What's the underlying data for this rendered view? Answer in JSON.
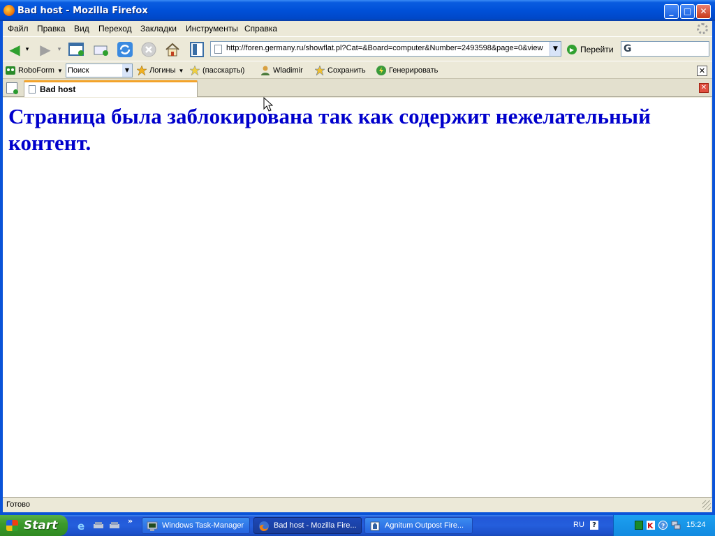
{
  "window": {
    "title": "Bad host - Mozilla Firefox",
    "controls": {
      "minimize": "_",
      "maximize": "□",
      "close": "✕"
    }
  },
  "menubar": {
    "items": [
      "Файл",
      "Правка",
      "Вид",
      "Переход",
      "Закладки",
      "Инструменты",
      "Справка"
    ]
  },
  "navbar": {
    "url": "http://foren.germany.ru/showflat.pl?Cat=&Board=computer&Number=2493598&page=0&view",
    "go_label": "Перейти",
    "search_engine_icon": "google-icon"
  },
  "robobar": {
    "roboform_label": "RoboForm",
    "search_value": "Поиск",
    "logins_label": "Логины",
    "passcards_label": "(пасскарты)",
    "user_label": "Wladimir",
    "save_label": "Сохранить",
    "generate_label": "Генерировать"
  },
  "tabs": [
    {
      "label": "Bad host",
      "active": true
    }
  ],
  "content": {
    "message": "Страница была заблокирована так как содержит нежелательный контент.",
    "message_color": "#0000cc"
  },
  "status": {
    "text": "Готово"
  },
  "taskbar": {
    "start_label": "Start",
    "quicklaunch_more": "»",
    "tasks": [
      {
        "label": "Windows Task-Manager",
        "icon": "task-manager-icon",
        "active": false
      },
      {
        "label": "Bad host - Mozilla Fire...",
        "icon": "firefox-icon",
        "active": true
      },
      {
        "label": "Agnitum Outpost Fire...",
        "icon": "outpost-icon",
        "active": false
      }
    ],
    "language": "RU",
    "help": "?",
    "clock": "15:24"
  }
}
